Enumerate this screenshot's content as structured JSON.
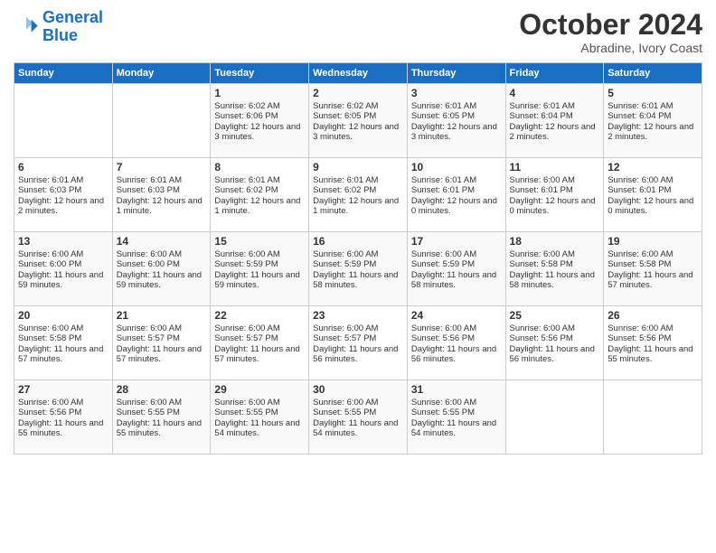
{
  "logo": {
    "line1": "General",
    "line2": "Blue"
  },
  "title": "October 2024",
  "subtitle": "Abradine, Ivory Coast",
  "days_header": [
    "Sunday",
    "Monday",
    "Tuesday",
    "Wednesday",
    "Thursday",
    "Friday",
    "Saturday"
  ],
  "weeks": [
    [
      {
        "day": "",
        "info": ""
      },
      {
        "day": "",
        "info": ""
      },
      {
        "day": "1",
        "info": "Sunrise: 6:02 AM\nSunset: 6:06 PM\nDaylight: 12 hours and 3 minutes."
      },
      {
        "day": "2",
        "info": "Sunrise: 6:02 AM\nSunset: 6:05 PM\nDaylight: 12 hours and 3 minutes."
      },
      {
        "day": "3",
        "info": "Sunrise: 6:01 AM\nSunset: 6:05 PM\nDaylight: 12 hours and 3 minutes."
      },
      {
        "day": "4",
        "info": "Sunrise: 6:01 AM\nSunset: 6:04 PM\nDaylight: 12 hours and 2 minutes."
      },
      {
        "day": "5",
        "info": "Sunrise: 6:01 AM\nSunset: 6:04 PM\nDaylight: 12 hours and 2 minutes."
      }
    ],
    [
      {
        "day": "6",
        "info": "Sunrise: 6:01 AM\nSunset: 6:03 PM\nDaylight: 12 hours and 2 minutes."
      },
      {
        "day": "7",
        "info": "Sunrise: 6:01 AM\nSunset: 6:03 PM\nDaylight: 12 hours and 1 minute."
      },
      {
        "day": "8",
        "info": "Sunrise: 6:01 AM\nSunset: 6:02 PM\nDaylight: 12 hours and 1 minute."
      },
      {
        "day": "9",
        "info": "Sunrise: 6:01 AM\nSunset: 6:02 PM\nDaylight: 12 hours and 1 minute."
      },
      {
        "day": "10",
        "info": "Sunrise: 6:01 AM\nSunset: 6:01 PM\nDaylight: 12 hours and 0 minutes."
      },
      {
        "day": "11",
        "info": "Sunrise: 6:00 AM\nSunset: 6:01 PM\nDaylight: 12 hours and 0 minutes."
      },
      {
        "day": "12",
        "info": "Sunrise: 6:00 AM\nSunset: 6:01 PM\nDaylight: 12 hours and 0 minutes."
      }
    ],
    [
      {
        "day": "13",
        "info": "Sunrise: 6:00 AM\nSunset: 6:00 PM\nDaylight: 11 hours and 59 minutes."
      },
      {
        "day": "14",
        "info": "Sunrise: 6:00 AM\nSunset: 6:00 PM\nDaylight: 11 hours and 59 minutes."
      },
      {
        "day": "15",
        "info": "Sunrise: 6:00 AM\nSunset: 5:59 PM\nDaylight: 11 hours and 59 minutes."
      },
      {
        "day": "16",
        "info": "Sunrise: 6:00 AM\nSunset: 5:59 PM\nDaylight: 11 hours and 58 minutes."
      },
      {
        "day": "17",
        "info": "Sunrise: 6:00 AM\nSunset: 5:59 PM\nDaylight: 11 hours and 58 minutes."
      },
      {
        "day": "18",
        "info": "Sunrise: 6:00 AM\nSunset: 5:58 PM\nDaylight: 11 hours and 58 minutes."
      },
      {
        "day": "19",
        "info": "Sunrise: 6:00 AM\nSunset: 5:58 PM\nDaylight: 11 hours and 57 minutes."
      }
    ],
    [
      {
        "day": "20",
        "info": "Sunrise: 6:00 AM\nSunset: 5:58 PM\nDaylight: 11 hours and 57 minutes."
      },
      {
        "day": "21",
        "info": "Sunrise: 6:00 AM\nSunset: 5:57 PM\nDaylight: 11 hours and 57 minutes."
      },
      {
        "day": "22",
        "info": "Sunrise: 6:00 AM\nSunset: 5:57 PM\nDaylight: 11 hours and 57 minutes."
      },
      {
        "day": "23",
        "info": "Sunrise: 6:00 AM\nSunset: 5:57 PM\nDaylight: 11 hours and 56 minutes."
      },
      {
        "day": "24",
        "info": "Sunrise: 6:00 AM\nSunset: 5:56 PM\nDaylight: 11 hours and 56 minutes."
      },
      {
        "day": "25",
        "info": "Sunrise: 6:00 AM\nSunset: 5:56 PM\nDaylight: 11 hours and 56 minutes."
      },
      {
        "day": "26",
        "info": "Sunrise: 6:00 AM\nSunset: 5:56 PM\nDaylight: 11 hours and 55 minutes."
      }
    ],
    [
      {
        "day": "27",
        "info": "Sunrise: 6:00 AM\nSunset: 5:56 PM\nDaylight: 11 hours and 55 minutes."
      },
      {
        "day": "28",
        "info": "Sunrise: 6:00 AM\nSunset: 5:55 PM\nDaylight: 11 hours and 55 minutes."
      },
      {
        "day": "29",
        "info": "Sunrise: 6:00 AM\nSunset: 5:55 PM\nDaylight: 11 hours and 54 minutes."
      },
      {
        "day": "30",
        "info": "Sunrise: 6:00 AM\nSunset: 5:55 PM\nDaylight: 11 hours and 54 minutes."
      },
      {
        "day": "31",
        "info": "Sunrise: 6:00 AM\nSunset: 5:55 PM\nDaylight: 11 hours and 54 minutes."
      },
      {
        "day": "",
        "info": ""
      },
      {
        "day": "",
        "info": ""
      }
    ]
  ]
}
